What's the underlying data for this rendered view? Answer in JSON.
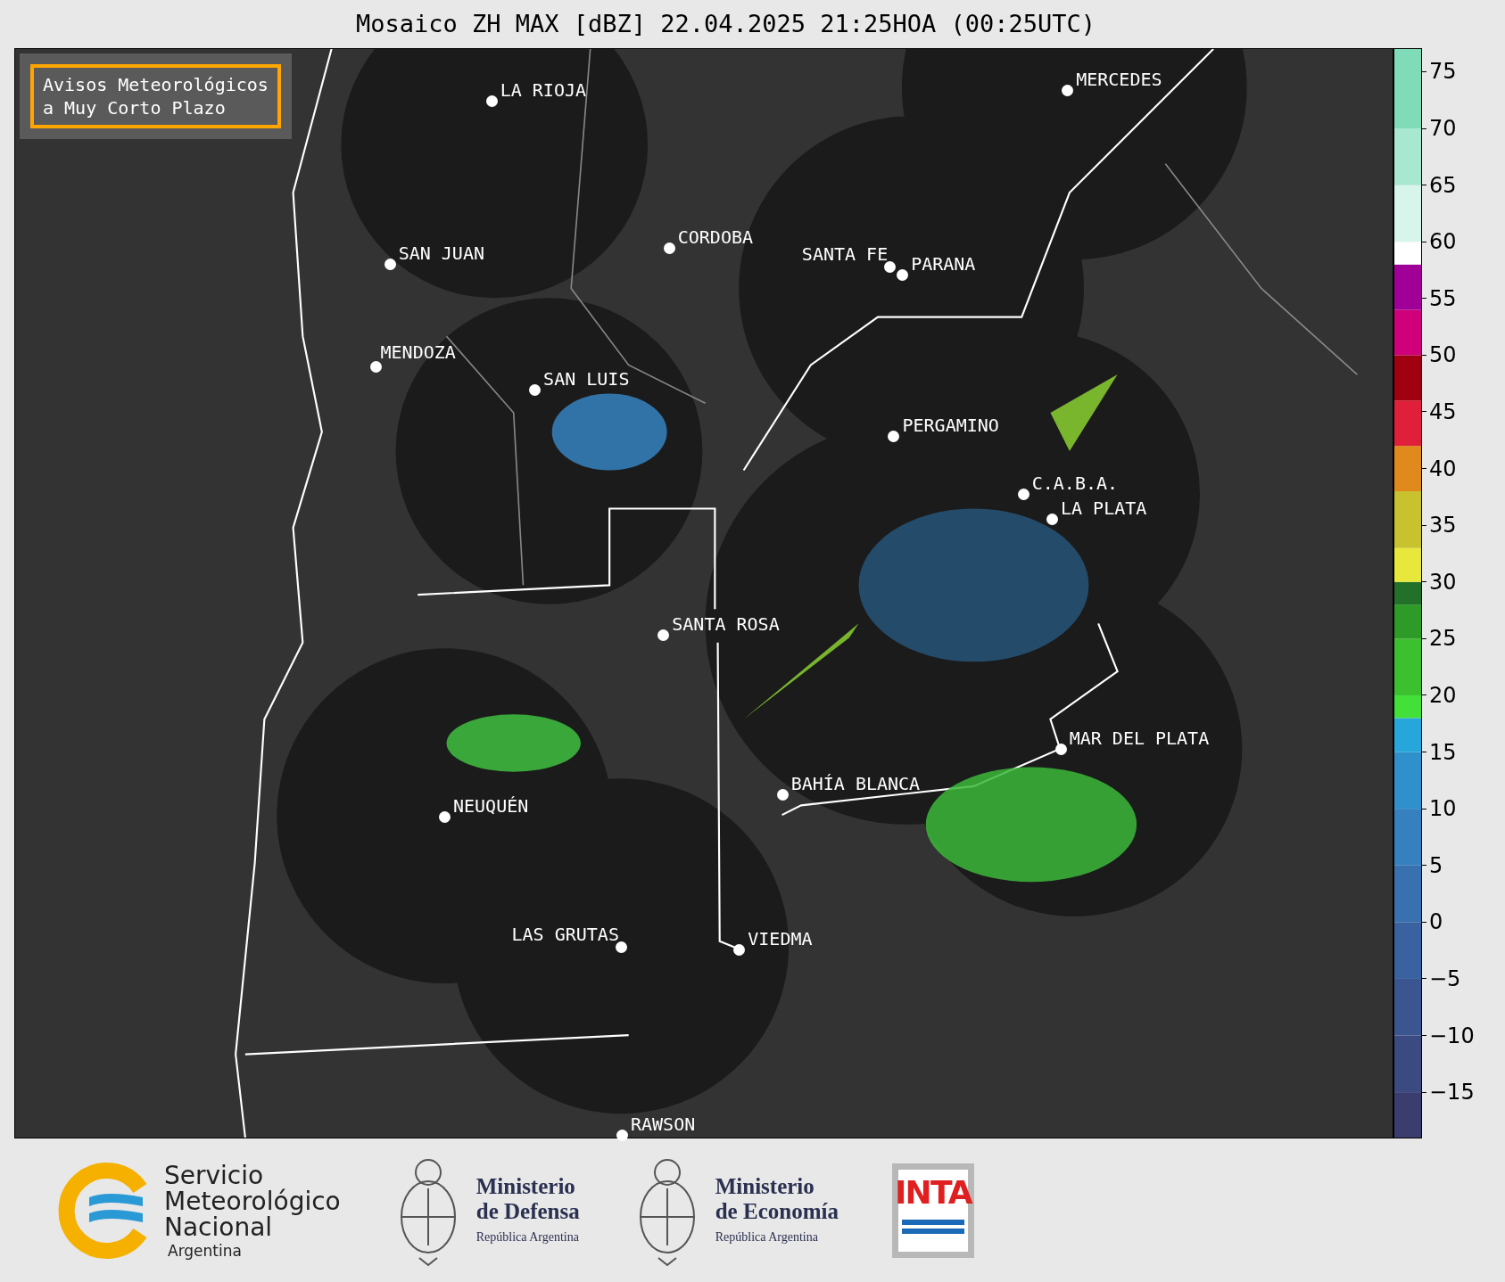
{
  "title": "Mosaico ZH MAX [dBZ] 22.04.2025 21:25HOA (00:25UTC)",
  "notice": {
    "lines": [
      "Avisos Meteorológicos",
      "a Muy Corto Plazo"
    ]
  },
  "cities": [
    {
      "name": "LA RIOJA"
    },
    {
      "name": "SAN JUAN"
    },
    {
      "name": "CORDOBA"
    },
    {
      "name": "SANTA FE"
    },
    {
      "name": "PARANA"
    },
    {
      "name": "MERCEDES"
    },
    {
      "name": "MENDOZA"
    },
    {
      "name": "SAN LUIS"
    },
    {
      "name": "PERGAMINO"
    },
    {
      "name": "C.A.B.A."
    },
    {
      "name": "LA PLATA"
    },
    {
      "name": "SANTA ROSA"
    },
    {
      "name": "MAR DEL PLATA"
    },
    {
      "name": "BAHÍA BLANCA"
    },
    {
      "name": "NEUQUÉN"
    },
    {
      "name": "LAS GRUTAS"
    },
    {
      "name": "VIEDMA"
    },
    {
      "name": "RAWSON"
    }
  ],
  "colorbar": {
    "ticks": [
      "75",
      "70",
      "65",
      "60",
      "55",
      "50",
      "45",
      "40",
      "35",
      "30",
      "25",
      "20",
      "15",
      "10",
      "5",
      "0",
      "−5",
      "−10",
      "−15"
    ]
  },
  "logos": [
    {
      "kind": "smn",
      "lines": [
        "Servicio",
        "Meteorológico",
        "Nacional",
        "Argentina"
      ]
    },
    {
      "kind": "ministry",
      "lines": [
        "Ministerio",
        "de Defensa",
        "República Argentina"
      ]
    },
    {
      "kind": "ministry",
      "lines": [
        "Ministerio",
        "de Economía",
        "República Argentina"
      ]
    },
    {
      "kind": "inta",
      "lines": [
        "INTA"
      ]
    }
  ]
}
